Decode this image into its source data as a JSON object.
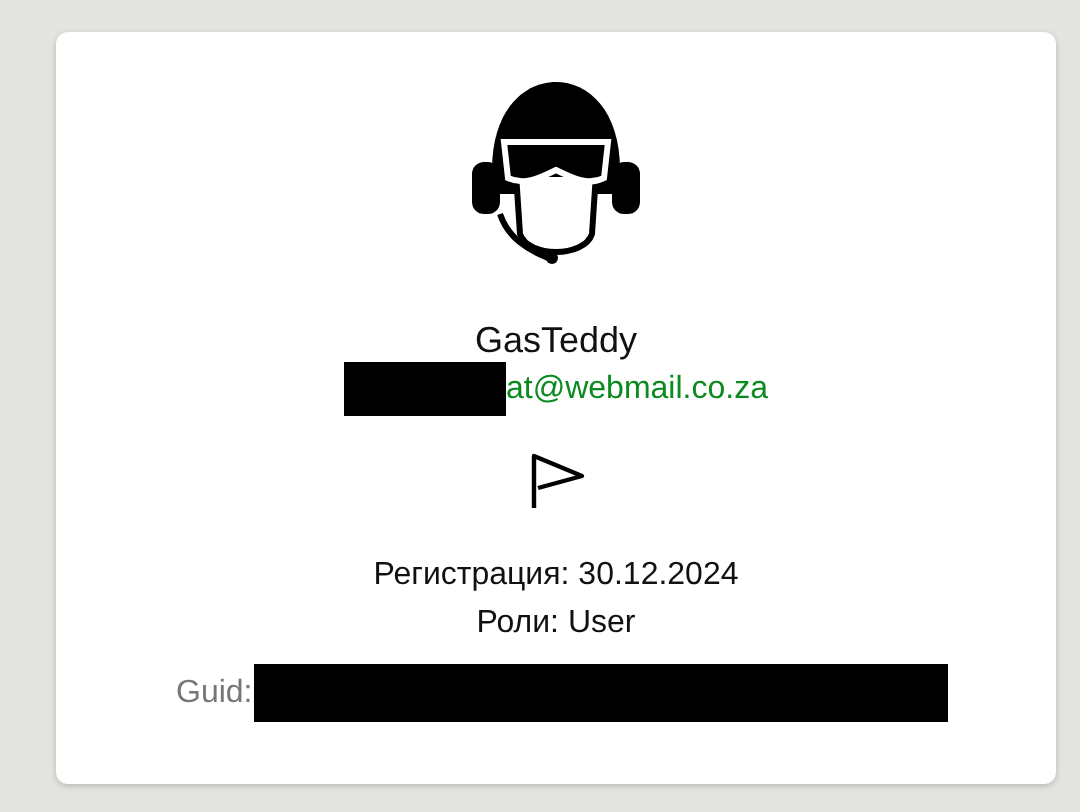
{
  "profile": {
    "name": "GasTeddy",
    "email": {
      "text": "at@webmail.co.za",
      "redacted": true
    },
    "registration": "Регистрация: 30.12.2024",
    "roles": "Роли: User",
    "guid": {
      "label": "Guid:",
      "redacted": true
    }
  }
}
